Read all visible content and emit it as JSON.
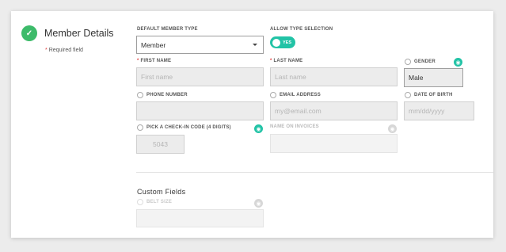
{
  "section": {
    "title": "Member Details",
    "required_note": "Required field",
    "required_star": "*"
  },
  "fields": {
    "member_type": {
      "label": "DEFAULT MEMBER TYPE",
      "value": "Member"
    },
    "allow_type": {
      "label": "ALLOW TYPE SELECTION",
      "toggle_text": "YES",
      "state": "on"
    },
    "first_name": {
      "label": "FIRST NAME",
      "placeholder": "First name"
    },
    "last_name": {
      "label": "LAST NAME",
      "placeholder": "Last name"
    },
    "gender": {
      "label": "GENDER",
      "value": "Male"
    },
    "phone": {
      "label": "PHONE NUMBER",
      "value": ""
    },
    "email": {
      "label": "EMAIL ADDRESS",
      "placeholder": "my@email.com"
    },
    "dob": {
      "label": "DATE OF BIRTH",
      "placeholder": "mm/dd/yyyy"
    },
    "checkin": {
      "label": "PICK A CHECK-IN CODE (4 DIGITS)",
      "value": "5043"
    },
    "invoice_name": {
      "label": "NAME ON INVOICES",
      "value": ""
    }
  },
  "custom_fields": {
    "title": "Custom Fields",
    "belt_size": {
      "label": "BELT SIZE",
      "value": ""
    }
  },
  "icons": {
    "check": "check-icon",
    "eye": "eye-icon",
    "accent_color": "#22c3a6",
    "success_color": "#3dbb6a",
    "required_color": "#e03b3b"
  }
}
